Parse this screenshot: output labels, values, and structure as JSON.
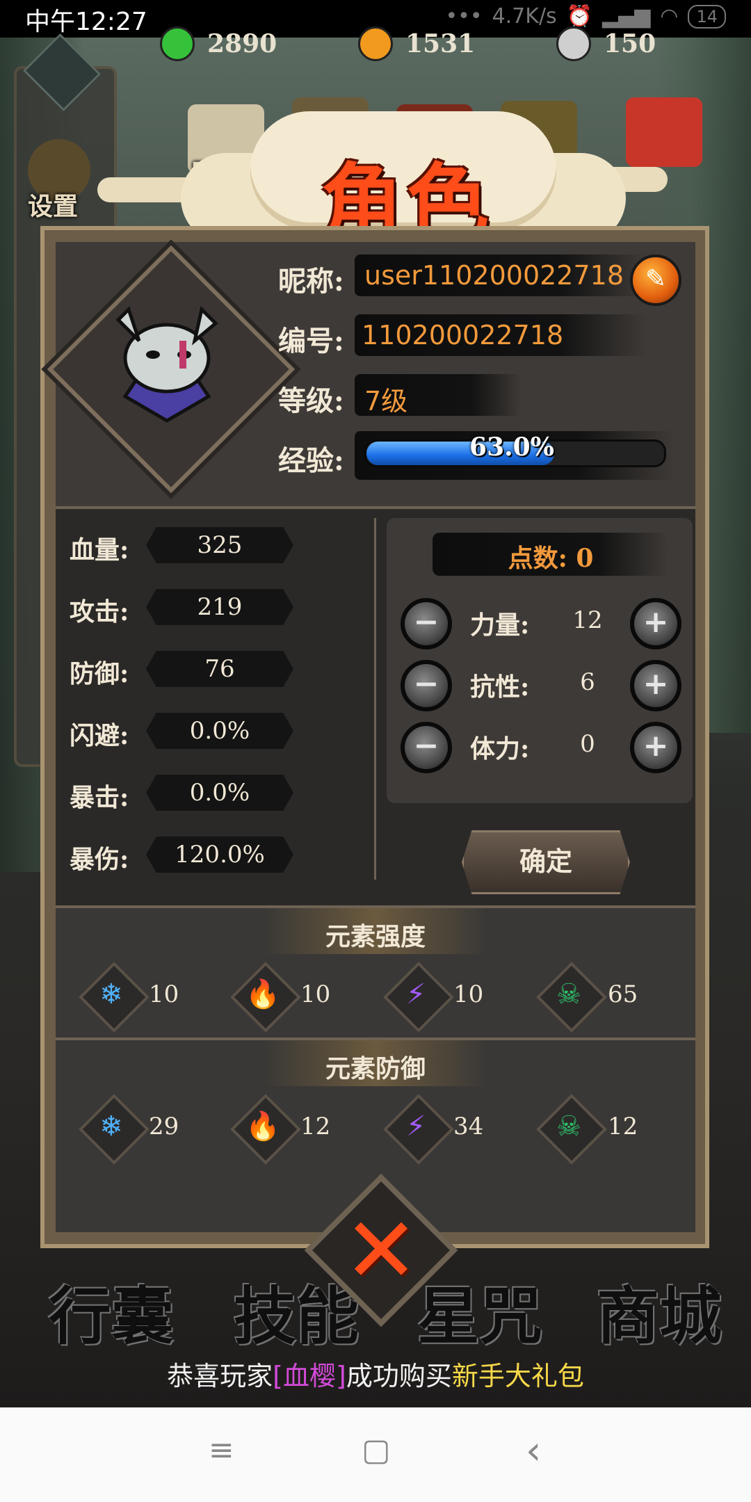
{
  "status_bar": {
    "time": "中午12:27",
    "net_speed": "4.7K/s",
    "battery": "14"
  },
  "currencies": [
    {
      "icon": "green-jade-icon",
      "value": "2890",
      "color": "#35c23a"
    },
    {
      "icon": "gold-coin-icon",
      "value": "1531",
      "color": "#f29a1e"
    },
    {
      "icon": "silver-orb-icon",
      "value": "150",
      "color": "#cfcfcf"
    }
  ],
  "top_menu": {
    "daily": "日常",
    "settings": "设置"
  },
  "title": "角色",
  "profile": {
    "nickname_label": "昵称:",
    "nickname": "user110200022718",
    "id_label": "编号:",
    "id": "110200022718",
    "level_label": "等级:",
    "level": "7级",
    "xp_label": "经验:",
    "xp_text": "63.0%",
    "xp_fraction": 0.63
  },
  "stats": [
    {
      "label": "血量:",
      "value": "325"
    },
    {
      "label": "攻击:",
      "value": "219"
    },
    {
      "label": "防御:",
      "value": "76"
    },
    {
      "label": "闪避:",
      "value": "0.0%"
    },
    {
      "label": "暴击:",
      "value": "0.0%"
    },
    {
      "label": "暴伤:",
      "value": "120.0%"
    }
  ],
  "points": {
    "title": "点数: 0",
    "attributes": [
      {
        "label": "力量:",
        "value": "12"
      },
      {
        "label": "抗性:",
        "value": "6"
      },
      {
        "label": "体力:",
        "value": "0"
      }
    ],
    "minus_symbol": "−",
    "plus_symbol": "+",
    "confirm": "确定"
  },
  "element_strength": {
    "title": "元素强度",
    "items": [
      {
        "icon": "ice-icon",
        "glyph": "❄",
        "value": "10",
        "color": "#4fb3ff"
      },
      {
        "icon": "fire-icon",
        "glyph": "🔥",
        "value": "10",
        "color": "#ff7a1a"
      },
      {
        "icon": "lightning-icon",
        "glyph": "⚡",
        "value": "10",
        "color": "#a55cff"
      },
      {
        "icon": "poison-skull-icon",
        "glyph": "☠",
        "value": "65",
        "color": "#2ec26a"
      }
    ]
  },
  "element_defense": {
    "title": "元素防御",
    "items": [
      {
        "icon": "ice-icon",
        "glyph": "❄",
        "value": "29",
        "color": "#4fb3ff"
      },
      {
        "icon": "fire-icon",
        "glyph": "🔥",
        "value": "12",
        "color": "#ff7a1a"
      },
      {
        "icon": "lightning-icon",
        "glyph": "⚡",
        "value": "34",
        "color": "#a55cff"
      },
      {
        "icon": "poison-skull-icon",
        "glyph": "☠",
        "value": "12",
        "color": "#2ec26a"
      }
    ]
  },
  "close_symbol": "✕",
  "bottom_nav": [
    "行囊",
    "技能",
    "星咒",
    "商城"
  ],
  "marquee": {
    "prefix": "恭喜玩家",
    "player": "[血樱]",
    "middle": "成功购买",
    "item": "新手大礼包"
  },
  "android_nav": {
    "menu": "≡",
    "home": "▢",
    "back": "‹"
  }
}
